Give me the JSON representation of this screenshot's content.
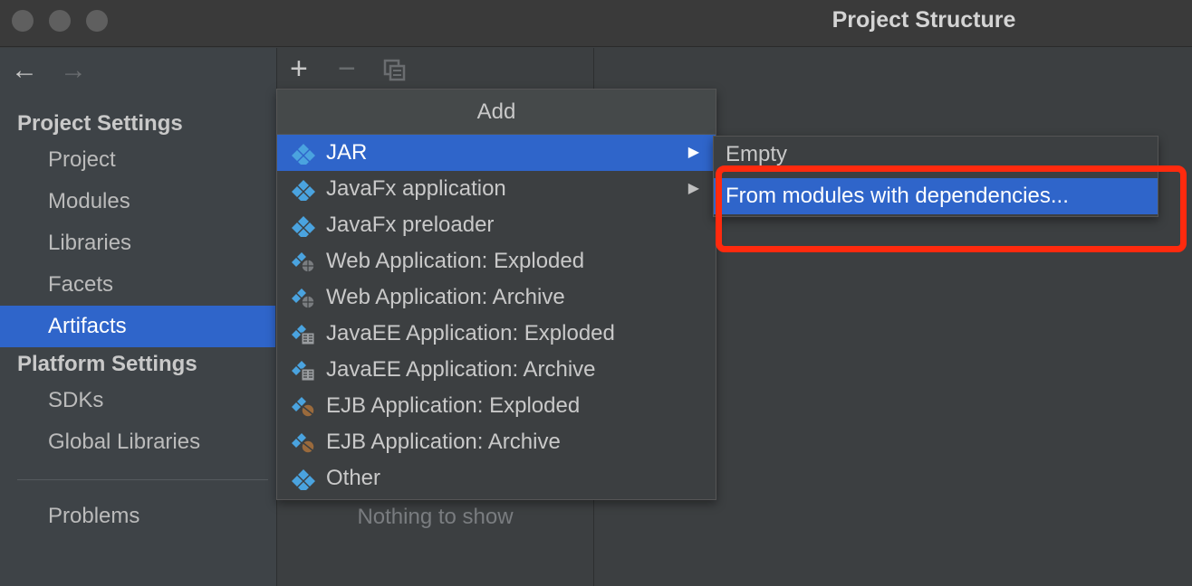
{
  "window": {
    "title": "Project Structure"
  },
  "colors": {
    "accent": "#2f65ca",
    "highlight": "#ff2a0e",
    "icon": "#4aa3df"
  },
  "nav": {
    "back_icon": "left-arrow-icon",
    "forward_icon": "right-arrow-icon"
  },
  "sidebar": {
    "project_settings": "Project Settings",
    "project_items": [
      "Project",
      "Modules",
      "Libraries",
      "Facets",
      "Artifacts"
    ],
    "selected": "Artifacts",
    "platform_settings": "Platform Settings",
    "platform_items": [
      "SDKs",
      "Global Libraries"
    ],
    "problems": "Problems"
  },
  "toolbar": {
    "add_icon": "plus-icon",
    "remove_icon": "minus-icon",
    "copy_icon": "copy-icon"
  },
  "artifacts": {
    "empty_text": "Nothing to show"
  },
  "add_menu": {
    "header": "Add",
    "items": [
      {
        "label": "JAR",
        "icon": "artifact-icon",
        "has_submenu": true,
        "selected": true
      },
      {
        "label": "JavaFx application",
        "icon": "artifact-icon",
        "has_submenu": true
      },
      {
        "label": "JavaFx preloader",
        "icon": "artifact-icon"
      },
      {
        "label": "Web Application: Exploded",
        "icon": "web-artifact-icon"
      },
      {
        "label": "Web Application: Archive",
        "icon": "web-artifact-icon"
      },
      {
        "label": "JavaEE Application: Exploded",
        "icon": "javaee-artifact-icon"
      },
      {
        "label": "JavaEE Application: Archive",
        "icon": "javaee-artifact-icon"
      },
      {
        "label": "EJB Application: Exploded",
        "icon": "ejb-artifact-icon"
      },
      {
        "label": "EJB Application: Archive",
        "icon": "ejb-artifact-icon"
      },
      {
        "label": "Other",
        "icon": "artifact-icon"
      }
    ]
  },
  "jar_submenu": {
    "items": [
      {
        "label": "Empty"
      },
      {
        "label": "From modules with dependencies...",
        "selected": true
      }
    ]
  }
}
